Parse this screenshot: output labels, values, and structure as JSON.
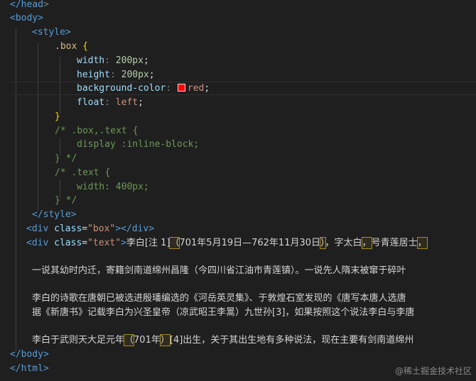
{
  "lines": {
    "l1": "</head",
    "l2": "<body>",
    "l3": "<style>",
    "l4_sel": ".box",
    "l4_brace": "{",
    "l5_prop": "width",
    "l5_val": "200px",
    "l6_prop": "height",
    "l6_val": "200px",
    "l7_prop": "background-color",
    "l7_val": "red",
    "l8_prop": "float",
    "l8_val": "left",
    "l9_brace": "}",
    "l10": "/* .box,.text {",
    "l11": "display :inline-block;",
    "l12": "} */",
    "l13": "/* .text {",
    "l14": "width: 400px;",
    "l15": "} */",
    "l16": "</style>",
    "l17_tag": "<div",
    "l17_attr": "class",
    "l17_str": "\"box\"",
    "l17_end": "></div>",
    "l18_tag": "<div",
    "l18_attr": "class",
    "l18_str": "\"text\"",
    "l18_gt": ">",
    "l18_t1": "李白[注 1]",
    "l18_h1": "（",
    "l18_t2": "701年5月19日—762年11月30日",
    "l18_h2": "）",
    "l18_t3": "，字太白",
    "l18_h3": "，",
    "l18_t4": "号青莲居士",
    "l18_h4": "，",
    "l20": "一说其幼时内迁，寄籍剑南道绵州昌隆（今四川省江油市青莲镇）。一说先人隋末被窜于碎叶",
    "l22": "李白的诗歌在唐朝已被选进殷璠编选的《河岳英灵集》、于敦煌石室发现的《唐写本唐人选唐",
    "l23": "据《新唐书》记载李白为兴圣皇帝（凉武昭王李暠）九世孙[3]，如果按照这个说法李白与李唐",
    "l25_t1": "李白于武则天大足元年",
    "l25_h1": "（",
    "l25_t2": "701年",
    "l25_h2": "）",
    "l25_t3": "[4]出生，关于其出生地有多种说法，现在主要有剑南道绵州",
    "l26": "</body>",
    "l27": "</html>"
  },
  "watermark": "@稀土掘金技术社区",
  "colors": {
    "background": "#1f1f1f",
    "tag": "#569cd6",
    "attribute": "#9cdcfe",
    "string": "#ce9178",
    "selector": "#d7ba7d",
    "number": "#b5cea8",
    "comment": "#6a9955",
    "swatch": "#ff0000"
  }
}
